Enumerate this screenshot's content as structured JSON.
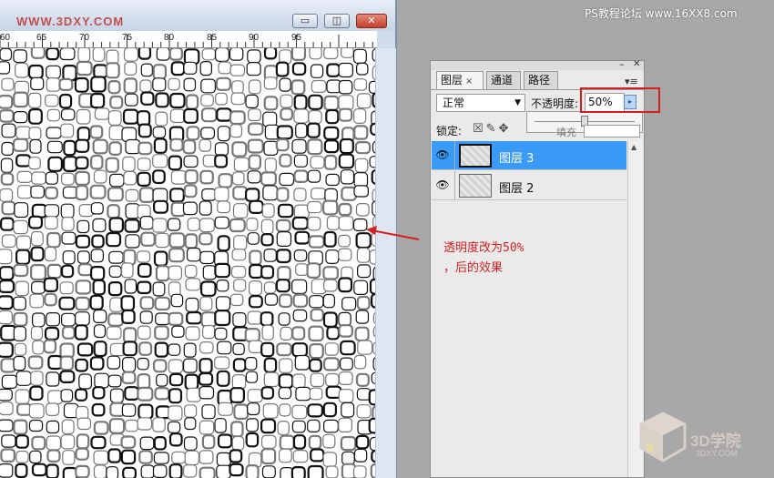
{
  "watermark_top": "PS教程论坛 www.16XX8.com",
  "document": {
    "title": "WWW.3DXY.COM",
    "min_symbol": "▭",
    "max_symbol": "◫",
    "close_symbol": "✕",
    "ruler_labels": [
      "60",
      "65",
      "70",
      "75",
      "80",
      "85",
      "90",
      "95"
    ]
  },
  "layers_panel": {
    "minimize_symbol": "–",
    "close_symbol": "✕",
    "tabs": [
      {
        "label": "图层",
        "close": "×",
        "active": true
      },
      {
        "label": "通道",
        "active": false
      },
      {
        "label": "路径",
        "active": false
      }
    ],
    "menu_symbol": "▾≡",
    "blend_mode": "正常",
    "opacity_label": "不透明度:",
    "opacity_value": "50%",
    "opacity_level": 0.5,
    "lock_label": "锁定:",
    "lock_icons": "☒✎✥",
    "fill_label": "填充",
    "layers": [
      {
        "name": "图层 3",
        "selected": true,
        "visible": true
      },
      {
        "name": "图层 2",
        "selected": false,
        "visible": true
      }
    ],
    "eye_icon": "👁",
    "scroll_up": "▲"
  },
  "annotation": {
    "line1": "透明度改为50%",
    "line2": "，后的效果",
    "color": "#d21f1f"
  },
  "logo": {
    "name": "3D学院",
    "sub": "3DXY.COM"
  }
}
